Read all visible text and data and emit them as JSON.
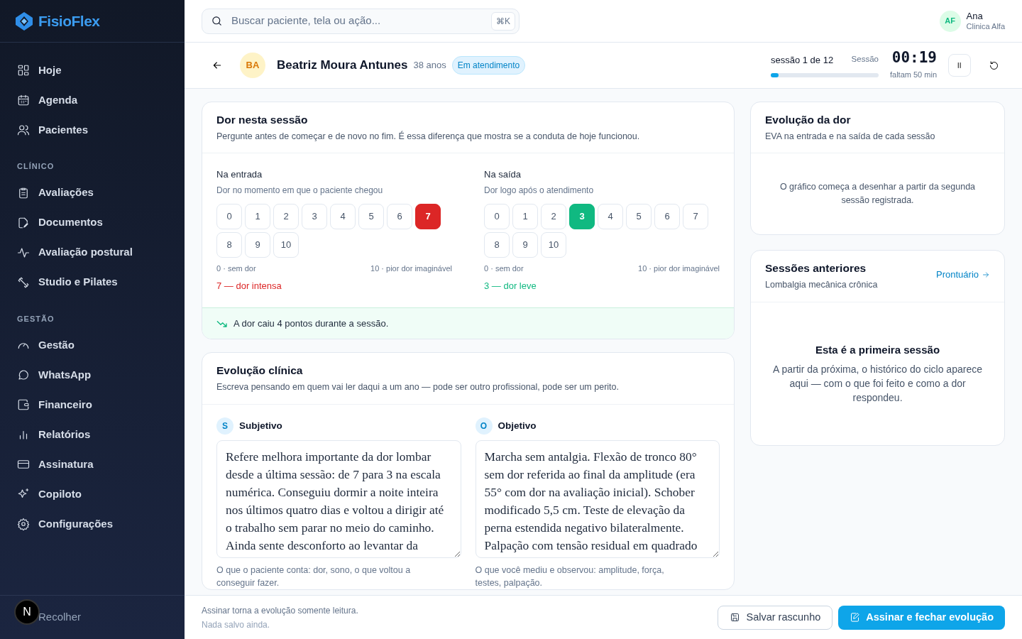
{
  "sidebar": {
    "brand": "FisioFlex",
    "groups": [
      {
        "items": [
          {
            "label": "Hoje"
          },
          {
            "label": "Agenda"
          },
          {
            "label": "Pacientes"
          }
        ]
      },
      {
        "heading": "CLÍNICO",
        "items": [
          {
            "label": "Avaliações"
          },
          {
            "label": "Documentos"
          },
          {
            "label": "Avaliação postural"
          },
          {
            "label": "Studio e Pilates"
          }
        ]
      },
      {
        "heading": "GESTÃO",
        "items": [
          {
            "label": "Gestão"
          },
          {
            "label": "WhatsApp"
          },
          {
            "label": "Financeiro"
          },
          {
            "label": "Relatórios"
          },
          {
            "label": "Assinatura"
          },
          {
            "label": "Copiloto"
          },
          {
            "label": "Configurações"
          }
        ]
      }
    ],
    "collapse": "Recolher",
    "dev_badge": "N"
  },
  "topbar": {
    "search": {
      "placeholder": "Buscar paciente, tela ou ação...",
      "shortcut": "⌘K"
    },
    "user": {
      "initials": "AF",
      "name": "Ana",
      "clinic": "Clinica Alfa"
    }
  },
  "patient": {
    "initials": "BA",
    "name": "Beatriz Moura Antunes",
    "age": "38 anos",
    "status": "Em atendimento",
    "session_label": "sessão 1 de 12",
    "session_caption": "Sessão",
    "level": 0.07,
    "timer": "00:19",
    "remaining": "faltam 50 min"
  },
  "pain_card": {
    "title": "Dor nesta sessão",
    "subtitle": "Pergunte antes de começar e de novo no fim. É essa diferença que mostra se a conduta de hoje funcionou.",
    "scales": [
      {
        "label": "Na entrada",
        "hint": "Dor no momento em que o paciente chegou",
        "color": "#dc2626",
        "min_label": "0 · sem dor",
        "max_label": "10 · pior dor imaginável",
        "result": "7 — dor intensa",
        "options": [
          {
            "label": "0",
            "selected": false
          },
          {
            "label": "1",
            "selected": false
          },
          {
            "label": "2",
            "selected": false
          },
          {
            "label": "3",
            "selected": false
          },
          {
            "label": "4",
            "selected": false
          },
          {
            "label": "5",
            "selected": false
          },
          {
            "label": "6",
            "selected": false
          },
          {
            "label": "7",
            "selected": true
          },
          {
            "label": "8",
            "selected": false
          },
          {
            "label": "9",
            "selected": false
          },
          {
            "label": "10",
            "selected": false
          }
        ]
      },
      {
        "label": "Na saída",
        "hint": "Dor logo após o atendimento",
        "color": "#10b981",
        "min_label": "0 · sem dor",
        "max_label": "10 · pior dor imaginável",
        "result": "3 — dor leve",
        "options": [
          {
            "label": "0",
            "selected": false
          },
          {
            "label": "1",
            "selected": false
          },
          {
            "label": "2",
            "selected": false
          },
          {
            "label": "3",
            "selected": true
          },
          {
            "label": "4",
            "selected": false
          },
          {
            "label": "5",
            "selected": false
          },
          {
            "label": "6",
            "selected": false
          },
          {
            "label": "7",
            "selected": false
          },
          {
            "label": "8",
            "selected": false
          },
          {
            "label": "9",
            "selected": false
          },
          {
            "label": "10",
            "selected": false
          }
        ]
      }
    ],
    "summary": "A dor caiu 4 pontos durante a sessão."
  },
  "evolution_card": {
    "title": "Evolução clínica",
    "subtitle": "Escreva pensando em quem vai ler daqui a um ano — pode ser outro profissional, pode ser um perito.",
    "fields": [
      {
        "letter": "S",
        "label": "Subjetivo",
        "value": "Refere melhora importante da dor lombar desde a última sessão: de 7 para 3 na escala numérica. Conseguiu dormir a noite inteira nos últimos quatro dias e voltou a dirigir até o trabalho sem parar no meio do caminho. Ainda sente desconforto ao levantar da",
        "help": "O que o paciente conta: dor, sono, o que voltou a conseguir fazer."
      },
      {
        "letter": "O",
        "label": "Objetivo",
        "value": "Marcha sem antalgia. Flexão de tronco 80° sem dor referida ao final da amplitude (era 55° com dor na avaliação inicial). Schober modificado 5,5 cm. Teste de elevação da perna estendida negativo bilateralmente. Palpação com tensão residual em quadrado",
        "help": "O que você mediu e observou: amplitude, força, testes, palpação."
      }
    ]
  },
  "pain_chart_card": {
    "title": "Evolução da dor",
    "subtitle": "EVA na entrada e na saída de cada sessão",
    "empty": "O gráfico começa a desenhar a partir da segunda sessão registrada."
  },
  "history_card": {
    "title": "Sessões anteriores",
    "subtitle": "Lombalgia mecânica crônica",
    "link": "Prontuário",
    "empty_title": "Esta é a primeira sessão",
    "empty_text": "A partir da próxima, o histórico do ciclo aparece aqui — com o que foi feito e como a dor respondeu."
  },
  "footer": {
    "note": "Assinar torna a evolução somente leitura.",
    "status": "Nada salvo ainda.",
    "draft": "Salvar rascunho",
    "sign": "Assinar e fechar evolução"
  }
}
